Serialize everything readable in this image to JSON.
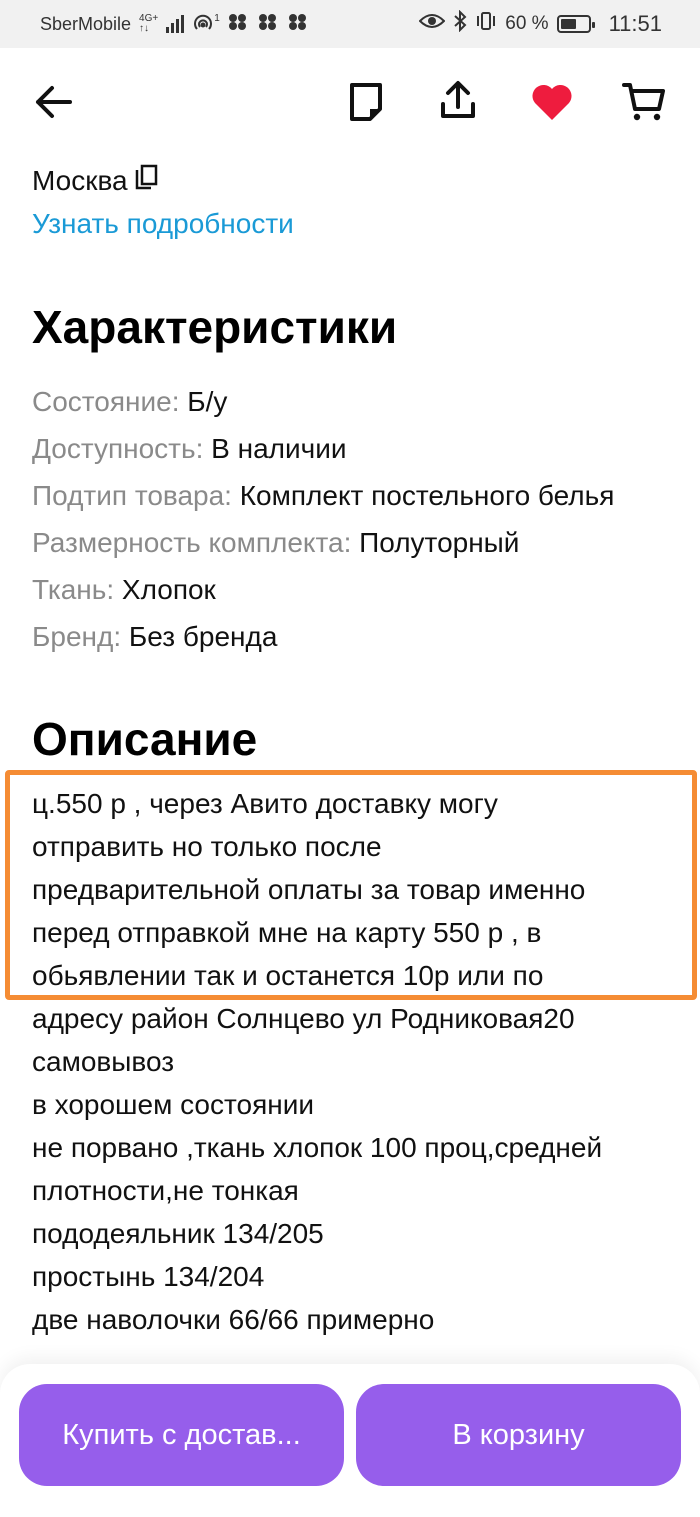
{
  "status_bar": {
    "carrier": "SberMobile",
    "network_top": "4G+",
    "network_bottom": "↑↓",
    "hotspot_sup": "1",
    "battery_percent": "60 %",
    "battery_level": 0.6,
    "time": "11:51"
  },
  "toolbar": {
    "back_icon": "arrow-left-icon",
    "note_icon": "note-icon",
    "share_icon": "share-icon",
    "favorite_icon": "heart-icon",
    "favorite_color": "#ee1c3e",
    "cart_icon": "cart-icon"
  },
  "location": {
    "city": "Москва",
    "details_link": "Узнать подробности",
    "link_color": "#1a9ad6"
  },
  "specs": {
    "title": "Характеристики",
    "rows": [
      {
        "key": "Состояние:",
        "value": "Б/у"
      },
      {
        "key": "Доступность:",
        "value": "В наличии"
      },
      {
        "key": "Подтип товара:",
        "value": "Комплект постельного белья"
      },
      {
        "key": "Размерность комплекта:",
        "value": "Полуторный"
      },
      {
        "key": "Ткань:",
        "value": "Хлопок"
      },
      {
        "key": "Бренд:",
        "value": "Без бренда"
      }
    ]
  },
  "description": {
    "title": "Описание",
    "lines": [
      "ц.550 р , через Авито доставку могу",
      "отправить но только после",
      "предварительной оплаты за товар именно",
      "перед отправкой мне на карту 550 р , в",
      "обьявлении так и останется 10р или по",
      "адресу район Солнцево ул Родниковая20",
      "самовывоз",
      "в хорошем состоянии",
      "не порвано ,ткань хлопок 100 проц,средней",
      "плотности,не тонкая",
      "пододеяльник 134/205",
      "простынь 134/204",
      "две наволочки 66/66 примерно"
    ],
    "highlight_color": "#f58c34"
  },
  "actions": {
    "buy_label": "Купить с достав...",
    "basket_label": "В корзину",
    "button_color": "#965eeb"
  }
}
